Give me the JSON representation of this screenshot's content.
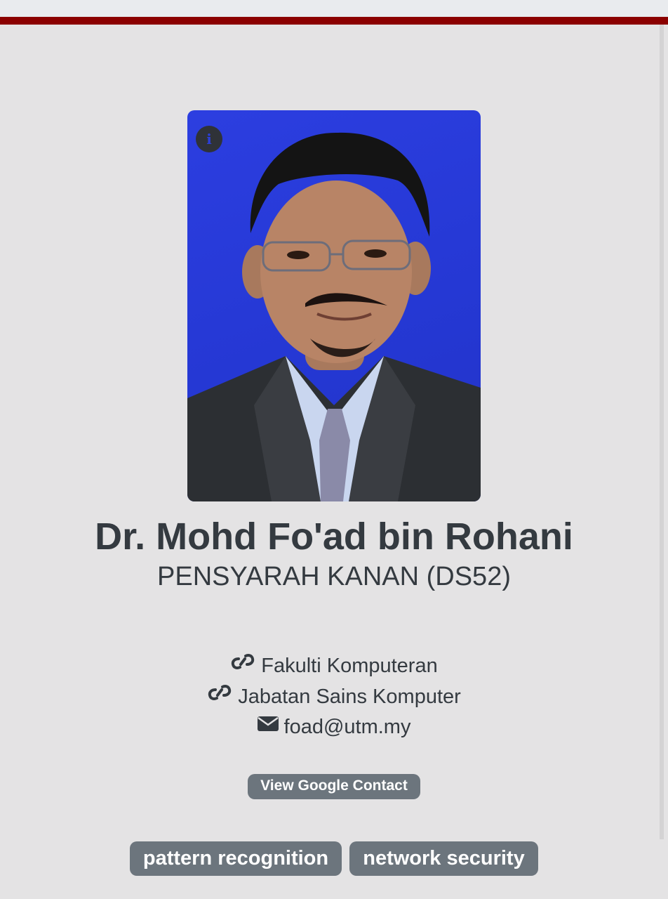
{
  "profile": {
    "name": "Dr. Mohd Fo'ad bin Rohani",
    "title": "PENSYARAH KANAN (DS52)",
    "photo_icon": "info-icon",
    "info_glyph": "i"
  },
  "details": {
    "faculty": "Fakulti Komputeran",
    "department": "Jabatan Sains Komputer",
    "email": "foad@utm.my"
  },
  "icons": {
    "faculty": "link-icon",
    "department": "link-icon",
    "email": "envelope-icon"
  },
  "contact_button": "View Google Contact",
  "tags": [
    "pattern recognition",
    "network security"
  ],
  "colors": {
    "top_bar": "#8b0000",
    "background": "#e4e3e4",
    "text": "#343a40",
    "button": "#6c757d",
    "photo_background": "#2b3fd8"
  }
}
